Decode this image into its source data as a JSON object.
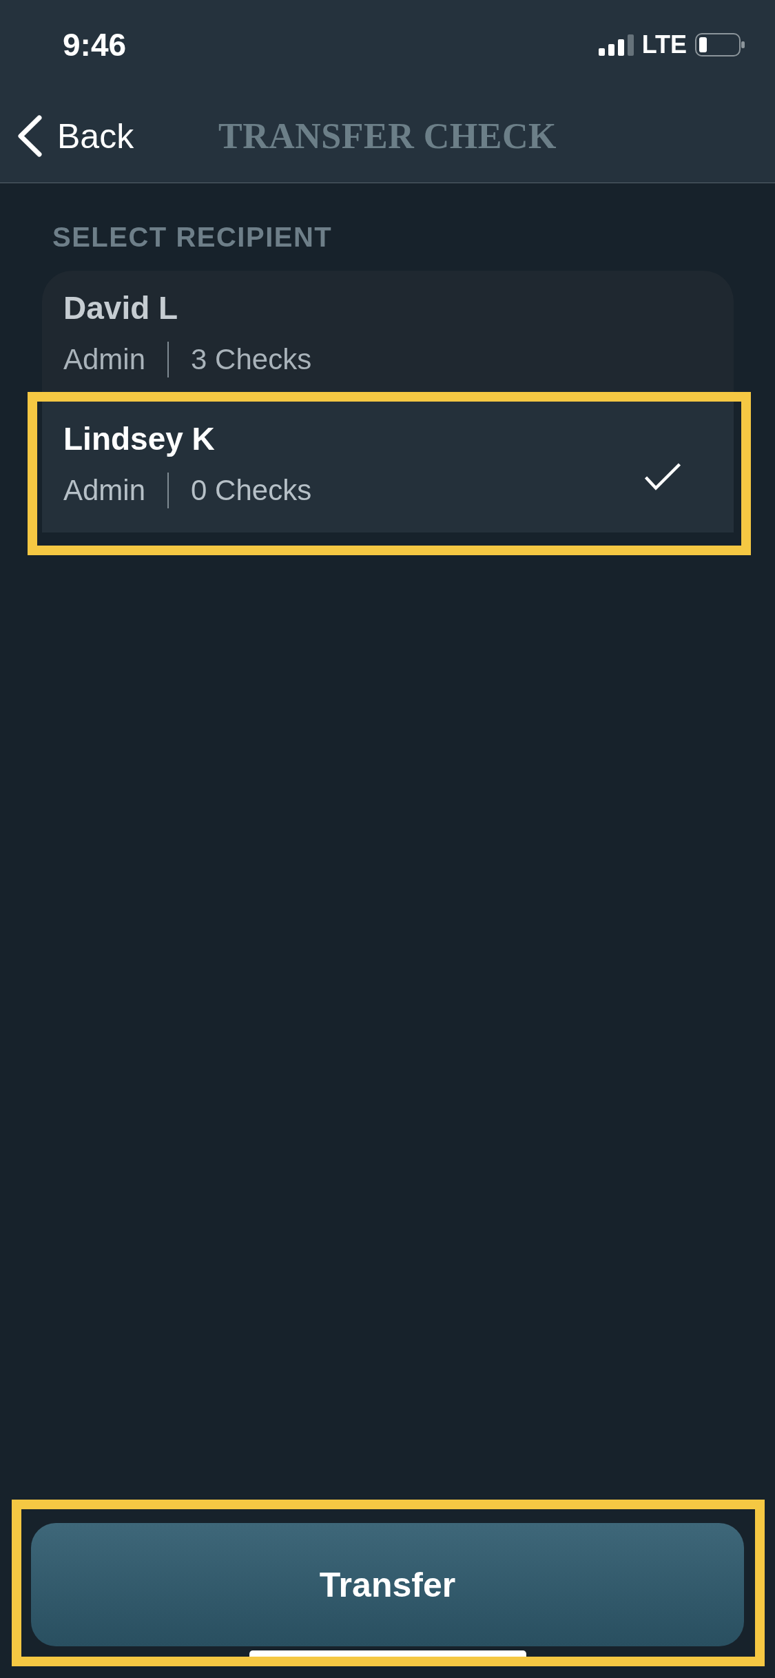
{
  "status_bar": {
    "time": "9:46",
    "network": "LTE"
  },
  "nav": {
    "back_label": "Back",
    "title": "TRANSFER CHECK"
  },
  "section_title": "SELECT RECIPIENT",
  "recipients": [
    {
      "name": "David L",
      "role": "Admin",
      "checks": "3 Checks",
      "selected": false,
      "highlighted": false
    },
    {
      "name": "Lindsey K",
      "role": "Admin",
      "checks": "0 Checks",
      "selected": true,
      "highlighted": true
    }
  ],
  "primary_button": {
    "label": "Transfer",
    "highlighted": true
  }
}
